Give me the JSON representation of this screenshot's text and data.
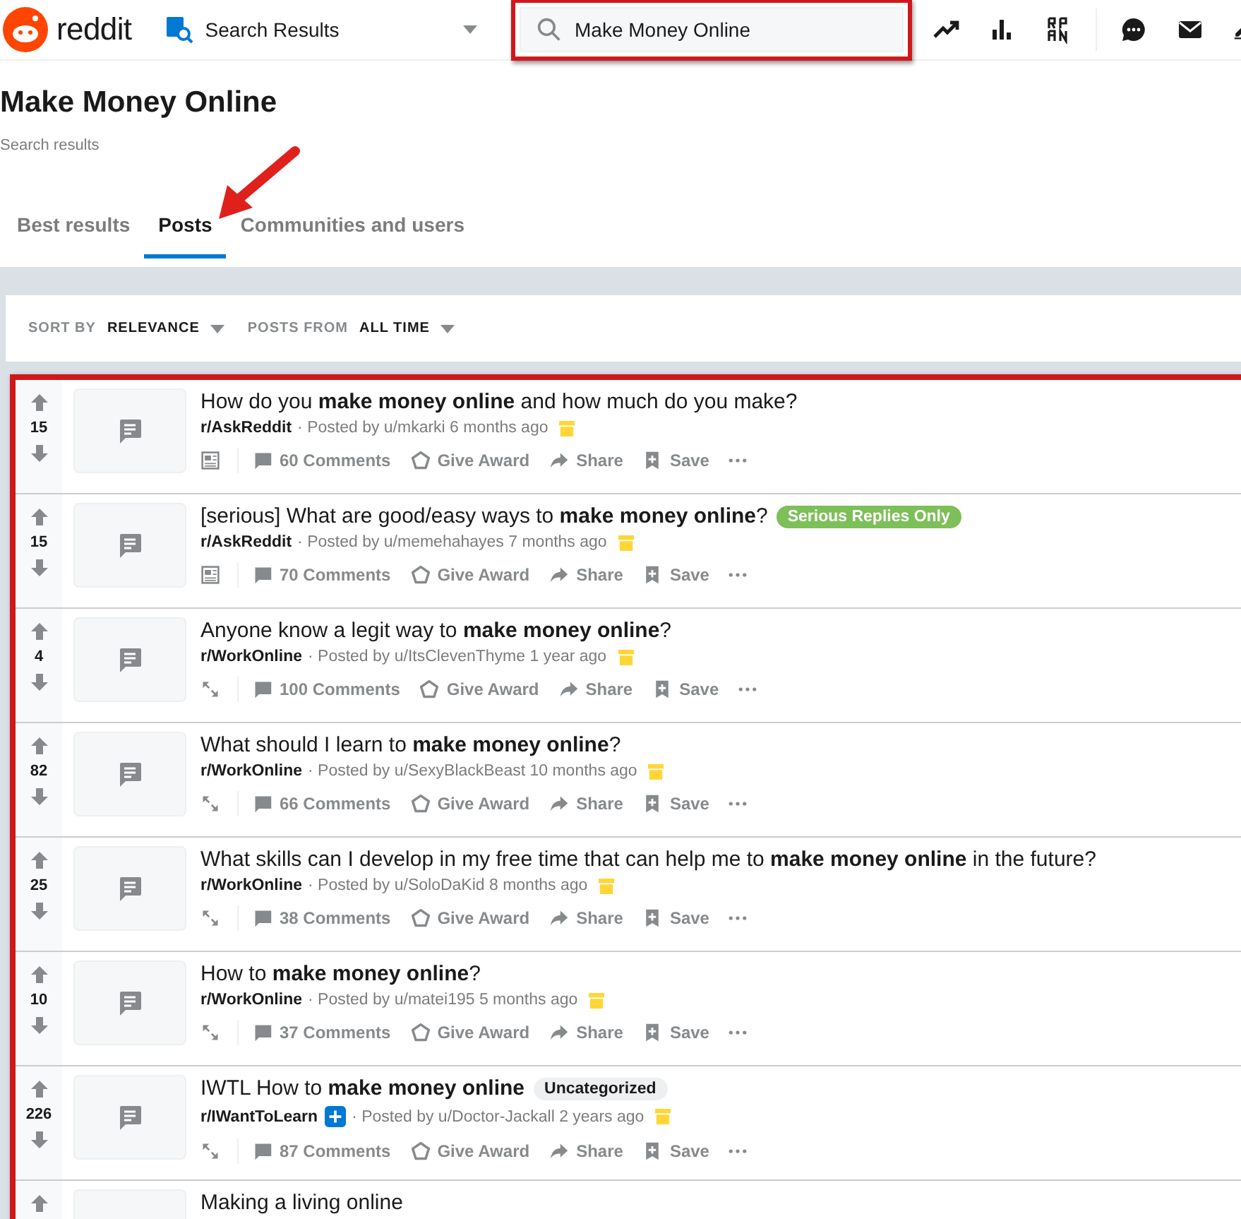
{
  "header": {
    "logo": "reddit",
    "location": "Search Results",
    "search": {
      "value": "Make Money Online"
    }
  },
  "page": {
    "title": "Make Money Online",
    "subtitle": "Search results"
  },
  "tabs": [
    {
      "label": "Best results",
      "selected": false
    },
    {
      "label": "Posts",
      "selected": true
    },
    {
      "label": "Communities and users",
      "selected": false
    }
  ],
  "sort": {
    "sort_label": "SORT BY",
    "sort_value": "RELEVANCE",
    "from_label": "POSTS FROM",
    "from_value": "ALL TIME"
  },
  "posts": [
    {
      "kind": "text",
      "score": "15",
      "title": "How do you **make money online** and how much do you make?",
      "subreddit": "r/AskReddit",
      "byline": "· Posted by u/mkarki 6 months ago",
      "comments": "60 Comments",
      "award": "Give Award",
      "share": "Share",
      "save": "Save"
    },
    {
      "kind": "text",
      "score": "15",
      "title": "[serious] What are good/easy ways to **make money online**?",
      "flair": {
        "text": "Serious Replies Only",
        "color": "#7dbf58"
      },
      "subreddit": "r/AskReddit",
      "byline": "· Posted by u/memehahayes 7 months ago",
      "comments": "70 Comments",
      "award": "Give Award",
      "share": "Share",
      "save": "Save"
    },
    {
      "kind": "link",
      "score": "4",
      "title": "Anyone know a legit way to **make money online**?",
      "subreddit": "r/WorkOnline",
      "byline": "· Posted by u/ItsClevenThyme 1 year ago",
      "comments": "100 Comments",
      "award": "Give Award",
      "share": "Share",
      "save": "Save"
    },
    {
      "kind": "link",
      "score": "82",
      "title": "What should I learn to **make money online**?",
      "subreddit": "r/WorkOnline",
      "byline": "· Posted by u/SexyBlackBeast 10 months ago",
      "comments": "66 Comments",
      "award": "Give Award",
      "share": "Share",
      "save": "Save"
    },
    {
      "kind": "link",
      "score": "25",
      "title": "What skills can I develop in my free time that can help me to **make money online** in the future?",
      "subreddit": "r/WorkOnline",
      "byline": "· Posted by u/SoloDaKid 8 months ago",
      "comments": "38 Comments",
      "award": "Give Award",
      "share": "Share",
      "save": "Save"
    },
    {
      "kind": "link",
      "score": "10",
      "title": "How to **make money online**?",
      "subreddit": "r/WorkOnline",
      "byline": "· Posted by u/matei195 5 months ago",
      "comments": "37 Comments",
      "award": "Give Award",
      "share": "Share",
      "save": "Save"
    },
    {
      "kind": "link",
      "score": "226",
      "title": "IWTL How to **make money online**",
      "flair": {
        "text": "Uncategorized",
        "color": "#edeff1"
      },
      "subreddit": "r/IWantToLearn",
      "plus_badge": true,
      "byline": "· Posted by u/Doctor-Jackall 2 years ago",
      "comments": "87 Comments",
      "award": "Give Award",
      "share": "Share",
      "save": "Save"
    },
    {
      "kind": "partial",
      "title": "Making a living online"
    }
  ]
}
